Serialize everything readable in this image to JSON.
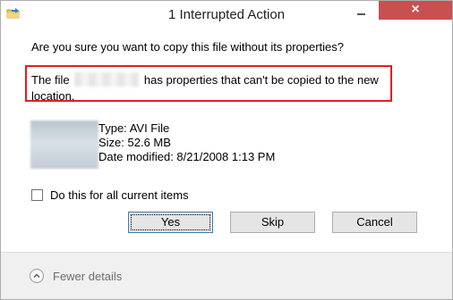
{
  "window": {
    "title": "1 Interrupted Action",
    "close_glyph": "×",
    "close_color": "#c75050"
  },
  "dialog": {
    "question": "Are you sure you want to copy this file without its properties?",
    "message_prefix": "The file",
    "message_suffix": "has properties that can't be copied to the new location.",
    "highlight_color": "#e02020"
  },
  "file": {
    "type_line": "Type: AVI File",
    "size_line": "Size: 52.6 MB",
    "modified_line": "Date modified: 8/21/2008 1:13 PM"
  },
  "checkbox": {
    "label": "Do this for all current items",
    "checked": false
  },
  "buttons": {
    "yes": "Yes",
    "skip": "Skip",
    "cancel": "Cancel"
  },
  "footer": {
    "details_label": "Fewer details",
    "icon": "chevron-up-icon"
  }
}
